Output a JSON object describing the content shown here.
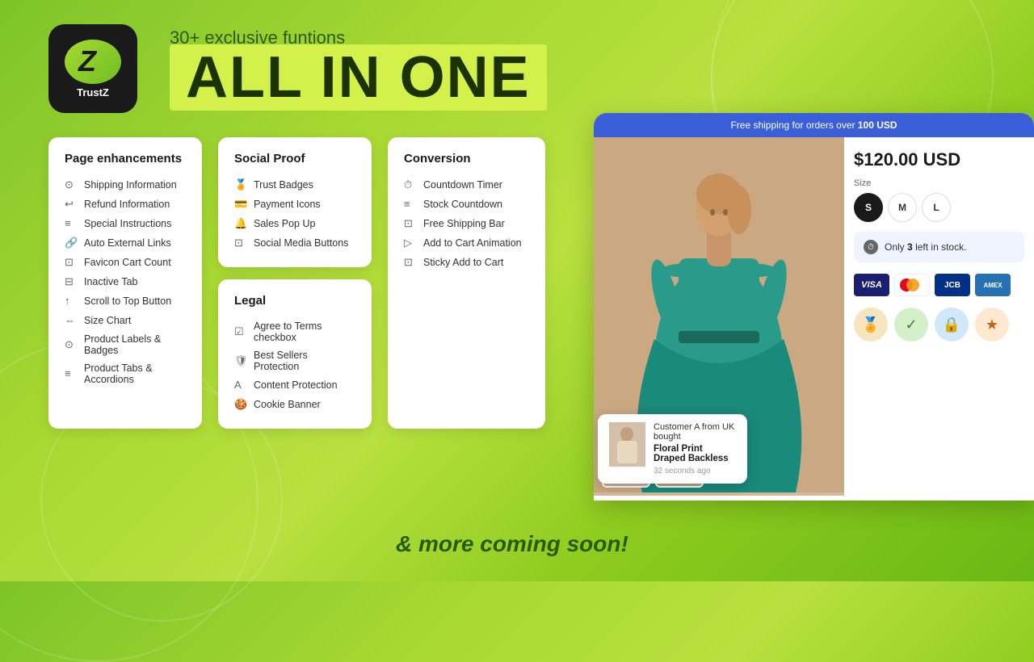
{
  "background": {
    "color": "linear-gradient(135deg, #7dc429, #a8d832, #6ab814)"
  },
  "logo": {
    "letter": "Z",
    "brand": "TrustZ"
  },
  "header": {
    "subtitle": "30+ exclusive funtions",
    "title": "ALL IN ONE"
  },
  "pageEnhancements": {
    "title": "Page enhancements",
    "items": [
      "Shipping Information",
      "Refund Information",
      "Special Instructions",
      "Auto External Links",
      "Favicon Cart Count",
      "Inactive Tab",
      "Scroll to Top Button",
      "Size Chart",
      "Product Labels & Badges",
      "Product Tabs & Accordions"
    ]
  },
  "socialProof": {
    "title": "Social Proof",
    "items": [
      "Trust Badges",
      "Payment Icons",
      "Sales Pop Up",
      "Social Media Buttons"
    ]
  },
  "legal": {
    "title": "Legal",
    "items": [
      "Agree to Terms checkbox",
      "Best Sellers Protection",
      "Content Protection",
      "Cookie Banner"
    ]
  },
  "conversion": {
    "title": "Conversion",
    "items": [
      "Countdown Timer",
      "Stock Countdown",
      "Free Shipping Bar",
      "Add to Cart Animation",
      "Sticky Add to Cart"
    ]
  },
  "tagline": "& more coming soon!",
  "product": {
    "shippingBar": "Free shipping for orders over",
    "shippingAmount": "100 USD",
    "price": "$120.00 USD",
    "sizeLabel": "Size",
    "sizes": [
      "S",
      "M",
      "L"
    ],
    "activeSize": "S",
    "stockAlert": "Only",
    "stockCount": "3",
    "stockSuffix": "left in stock.",
    "popup": {
      "customer": "Customer A from UK",
      "action": "bought",
      "product": "Floral Print Draped Backless",
      "time": "32 seconds ago"
    }
  }
}
